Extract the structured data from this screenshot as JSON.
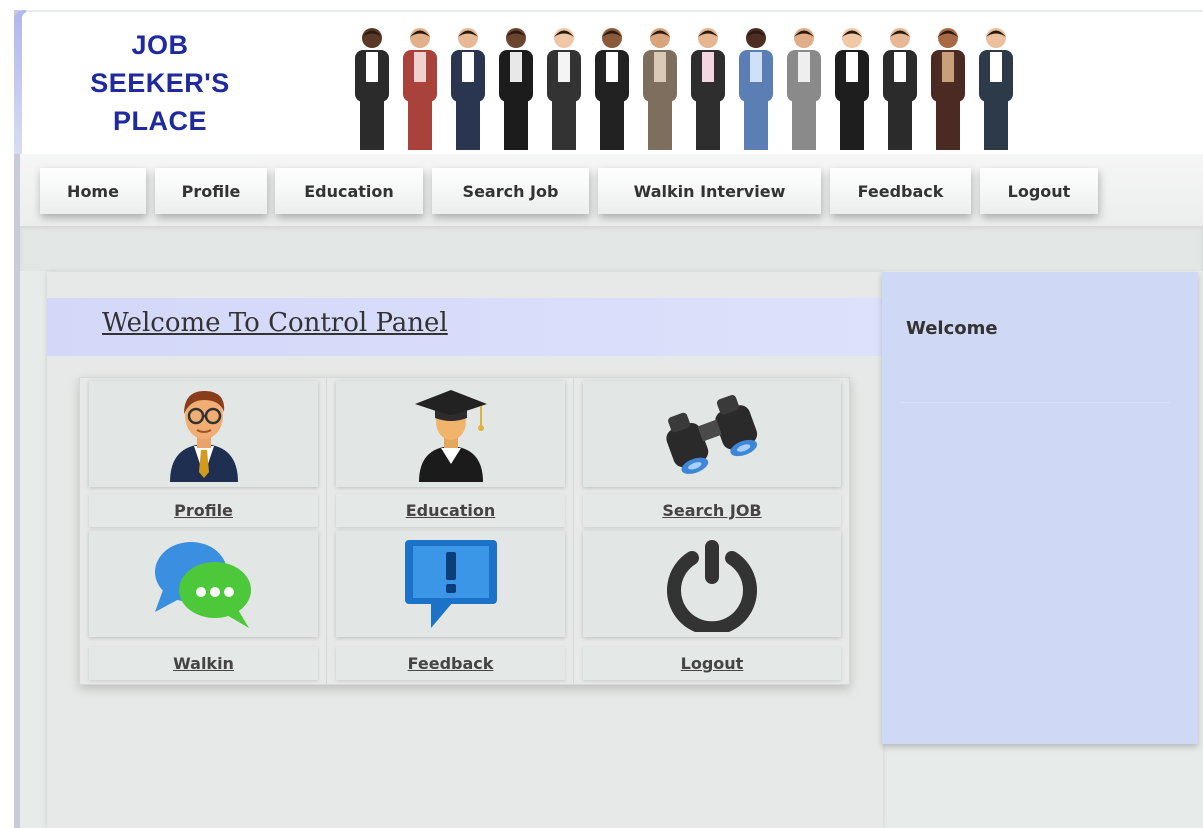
{
  "header": {
    "logo_lines": [
      "JOB",
      "SEEKER'S",
      "PLACE"
    ],
    "banner_icon": "group-of-people-banner"
  },
  "nav": {
    "items": [
      "Home",
      "Profile",
      "Education",
      "Search Job",
      "Walkin Interview",
      "Feedback",
      "Logout"
    ]
  },
  "main": {
    "title": "Welcome To Control Panel",
    "tiles": [
      {
        "label": "Profile",
        "icon": "user-icon"
      },
      {
        "label": "Education",
        "icon": "graduate-icon"
      },
      {
        "label": "Search JOB",
        "icon": "binoculars-icon"
      },
      {
        "label": "Walkin",
        "icon": "chat-bubbles-icon"
      },
      {
        "label": "Feedback",
        "icon": "feedback-icon"
      },
      {
        "label": "Logout",
        "icon": "power-icon"
      }
    ]
  },
  "sidebar": {
    "title": "Welcome"
  },
  "colors": {
    "logo": "#1e2a9e",
    "sidebar_bg": "#cfd9f5",
    "banner_bg": "#d3d8f9",
    "page_bg": "#e7ebe9"
  }
}
